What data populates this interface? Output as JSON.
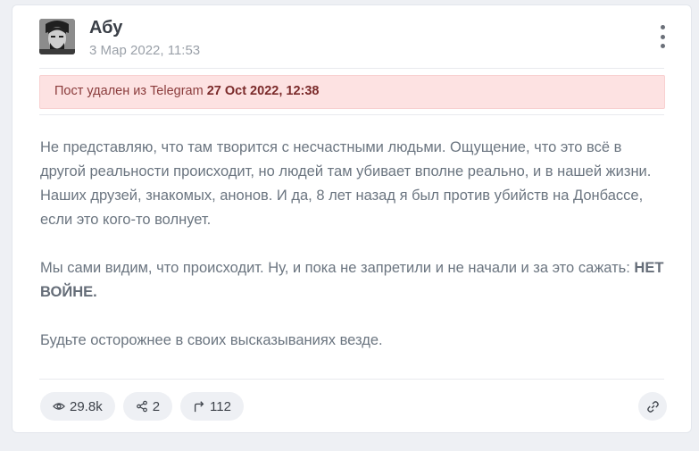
{
  "post": {
    "author": "Абу",
    "date": "3 Мар 2022, 11:53",
    "deleted_notice_prefix": "Пост удален из Telegram",
    "deleted_notice_date": "27 Oct 2022, 12:38",
    "paragraph1": "Не представляю, что там творится с несчастными людьми. Ощущение, что это всё в другой реальности происходит, но людей там убивает вполне реально, и в нашей жизни. Наших друзей, знакомых, анонов. И да, 8 лет назад я был против убийств на Донбассе, если это кого-то волнует.",
    "paragraph2_text": "Мы сами видим, что происходит. Ну, и пока не запретили и не начали и за это сажать: ",
    "paragraph2_bold": "НЕТ ВОЙНЕ.",
    "paragraph3": "Будьте осторожнее в своих высказываниях везде."
  },
  "stats": {
    "views": "29.8k",
    "shares": "2",
    "forwards": "112"
  },
  "icons": {
    "views": "eye-icon",
    "shares": "share-icon",
    "forwards": "forward-icon",
    "link": "link-icon",
    "menu": "more-vertical-icon"
  }
}
